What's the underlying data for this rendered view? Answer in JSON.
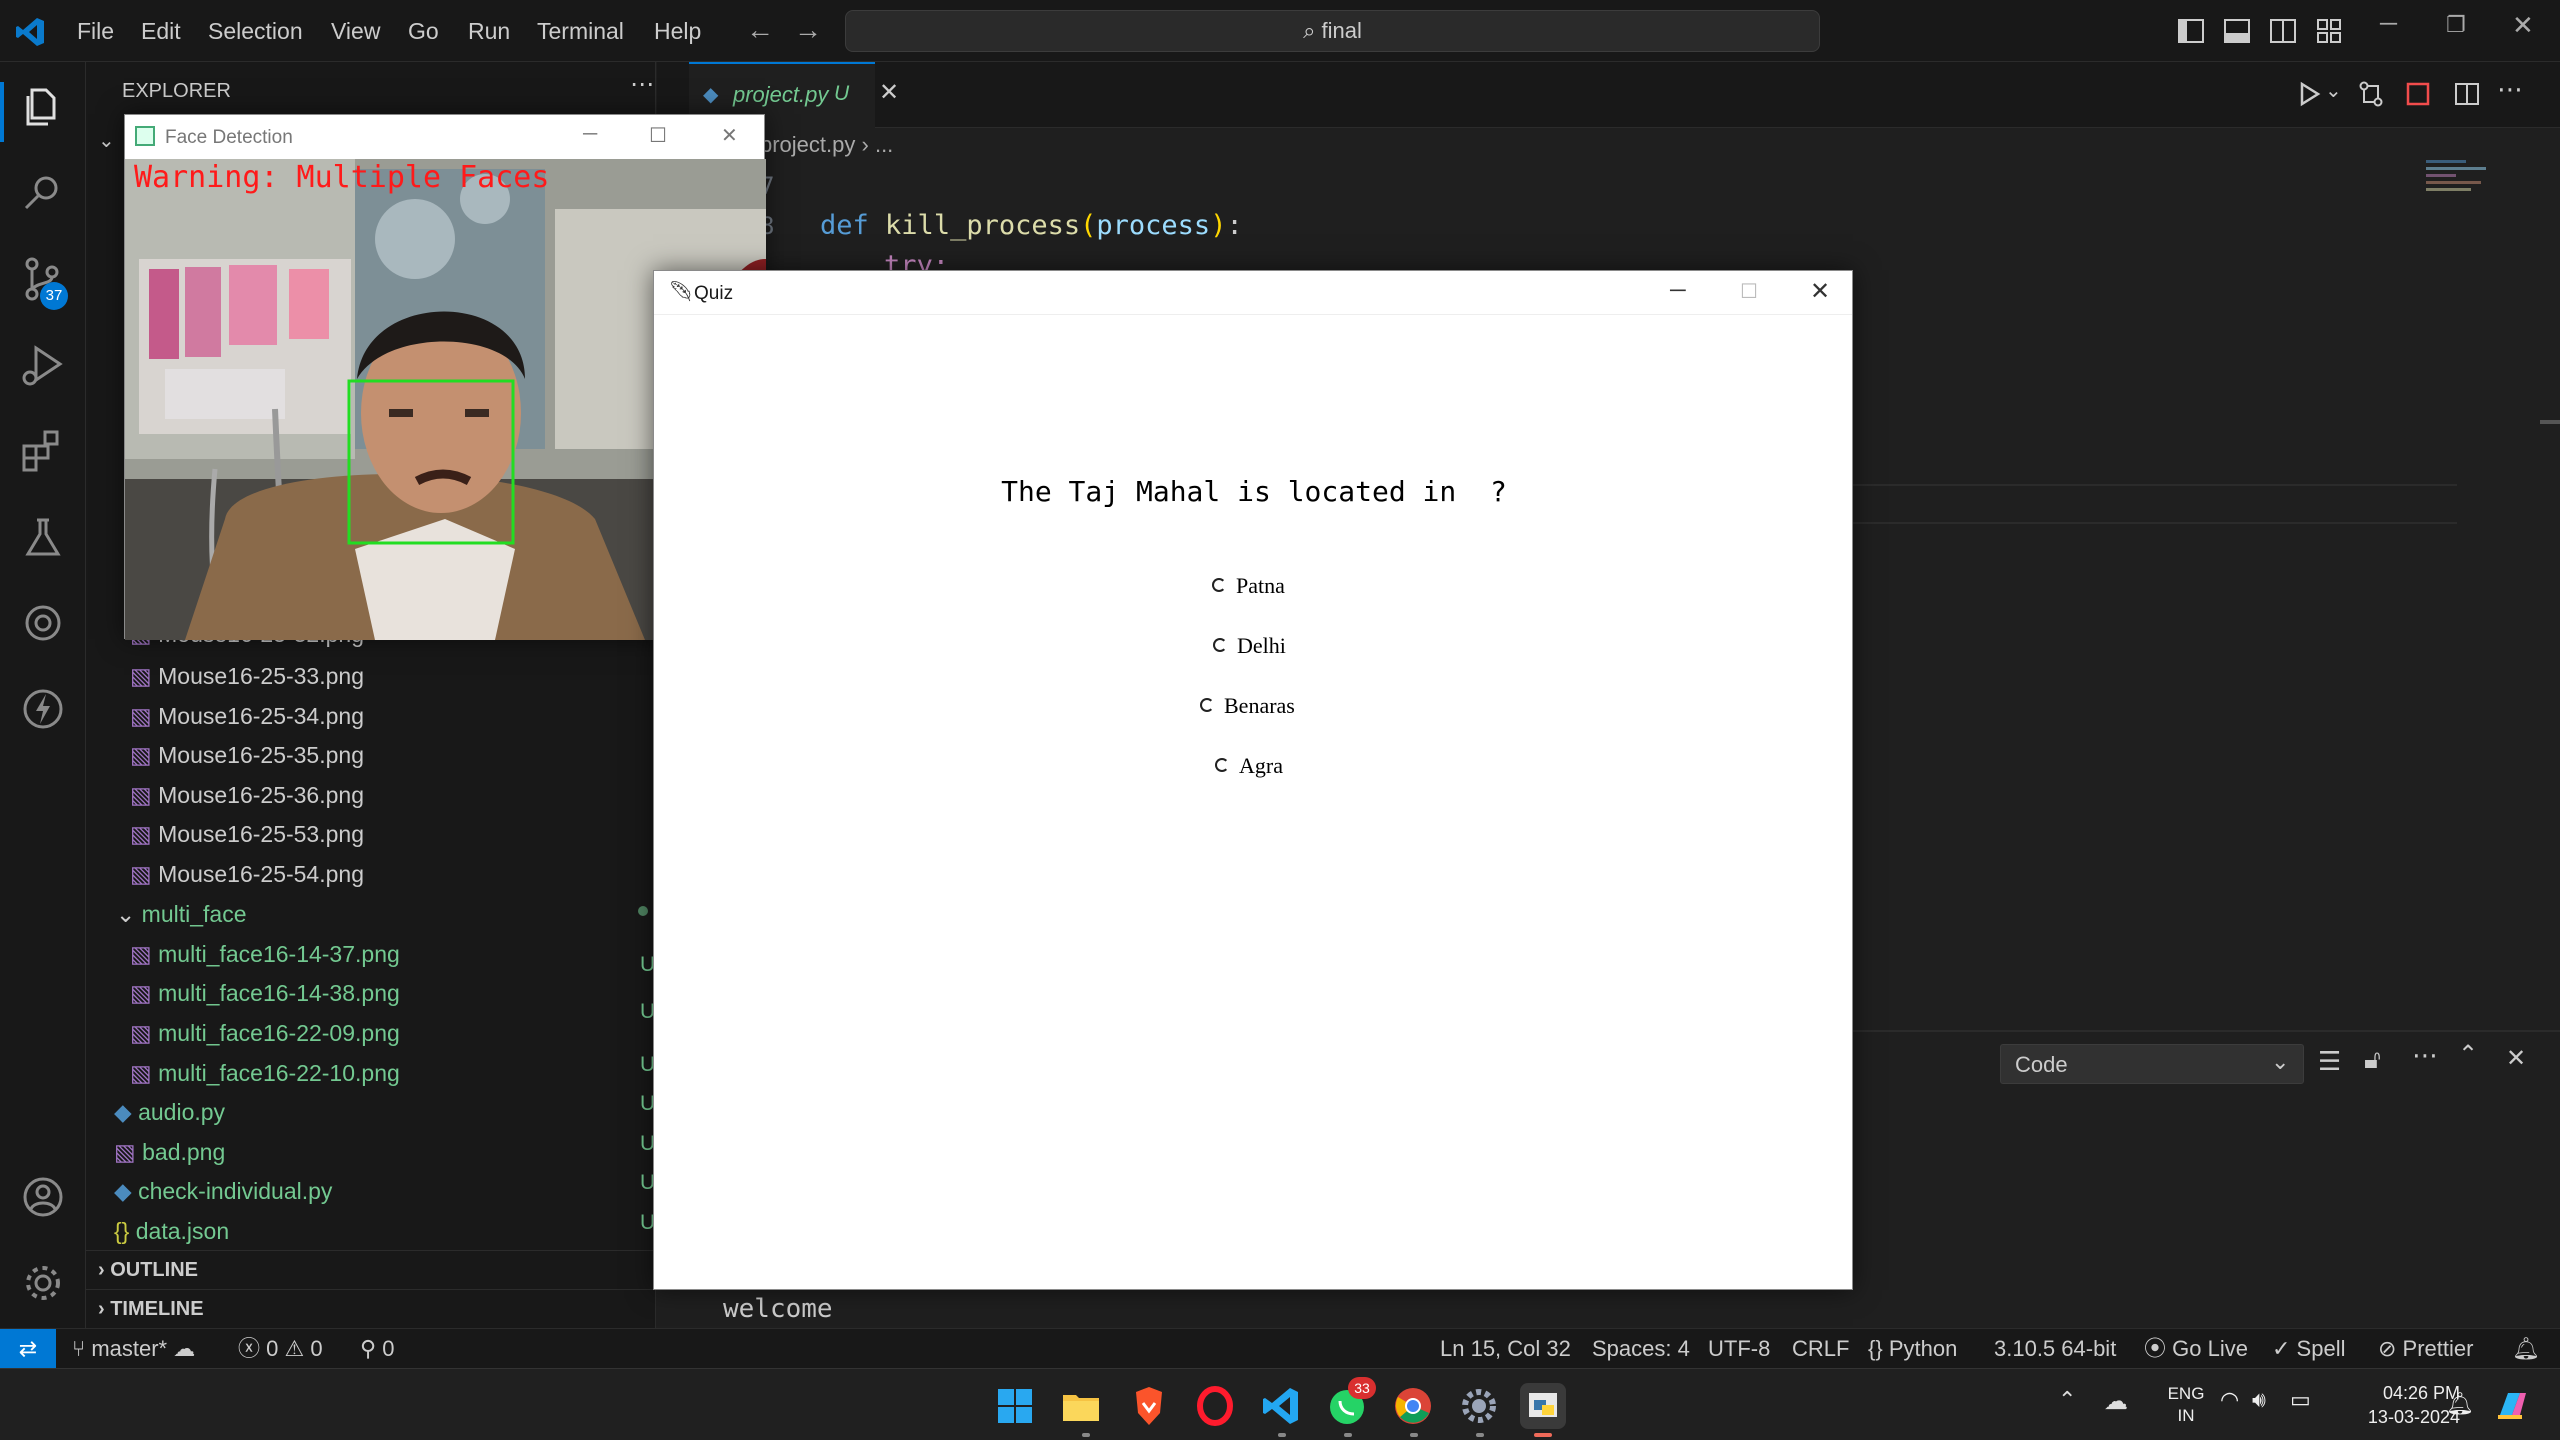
{
  "menu": [
    "File",
    "Edit",
    "Selection",
    "View",
    "Go",
    "Run",
    "Terminal",
    "Help"
  ],
  "command_center": "final",
  "source_control_badge": "37",
  "explorer": {
    "title": "EXPLORER",
    "files_above": [
      "Mouse16-25-32.png"
    ],
    "mouse_files": [
      "Mouse16-25-33.png",
      "Mouse16-25-34.png",
      "Mouse16-25-35.png",
      "Mouse16-25-36.png",
      "Mouse16-25-53.png",
      "Mouse16-25-54.png"
    ],
    "folder": "multi_face",
    "multi_files": [
      "multi_face16-14-37.png",
      "multi_face16-14-38.png",
      "multi_face16-22-09.png",
      "multi_face16-22-10.png"
    ],
    "root_files": [
      {
        "name": "audio.py",
        "icon": "python-file-icon"
      },
      {
        "name": "bad.png",
        "icon": "image-file-icon"
      },
      {
        "name": "check-individual.py",
        "icon": "python-file-icon"
      },
      {
        "name": "data.json",
        "icon": "json-file-icon"
      }
    ],
    "untracked_flag": "U",
    "outline": "OUTLINE",
    "timeline": "TIMELINE"
  },
  "editor": {
    "tab_name": "project.py",
    "tab_status": "U",
    "breadcrumb_file": "project.py",
    "breadcrumb_more": "...",
    "line_number": "8",
    "code_keyword": "def",
    "code_func": "kill_process",
    "code_param": "process",
    "code_line2": "try:",
    "panel_dropdown": "Code",
    "terminal_output": "welcome"
  },
  "face_window": {
    "title": "Face Detection",
    "warning": "Warning: Multiple Faces"
  },
  "quiz_window": {
    "title": "Quiz",
    "question": "The Taj Mahal is located in  ?",
    "options": [
      "Patna",
      "Delhi",
      "Benaras",
      "Agra"
    ]
  },
  "status": {
    "branch": "master*",
    "errors": "0",
    "warnings": "0",
    "ports": "0",
    "position": "Ln 15, Col 32",
    "spaces": "Spaces: 4",
    "encoding": "UTF-8",
    "eol": "CRLF",
    "language": "Python",
    "interpreter": "3.10.5 64-bit",
    "golive": "Go Live",
    "spell": "Spell",
    "prettier": "Prettier"
  },
  "taskbar": {
    "whatsapp_badge": "33",
    "lang_top": "ENG",
    "lang_bottom": "IN",
    "time": "04:26 PM",
    "date": "13-03-2024"
  },
  "colors": {
    "accent": "#0078d4",
    "untracked": "#73c991",
    "warning_text": "#ff1a1a",
    "face_box": "#22dd22"
  }
}
